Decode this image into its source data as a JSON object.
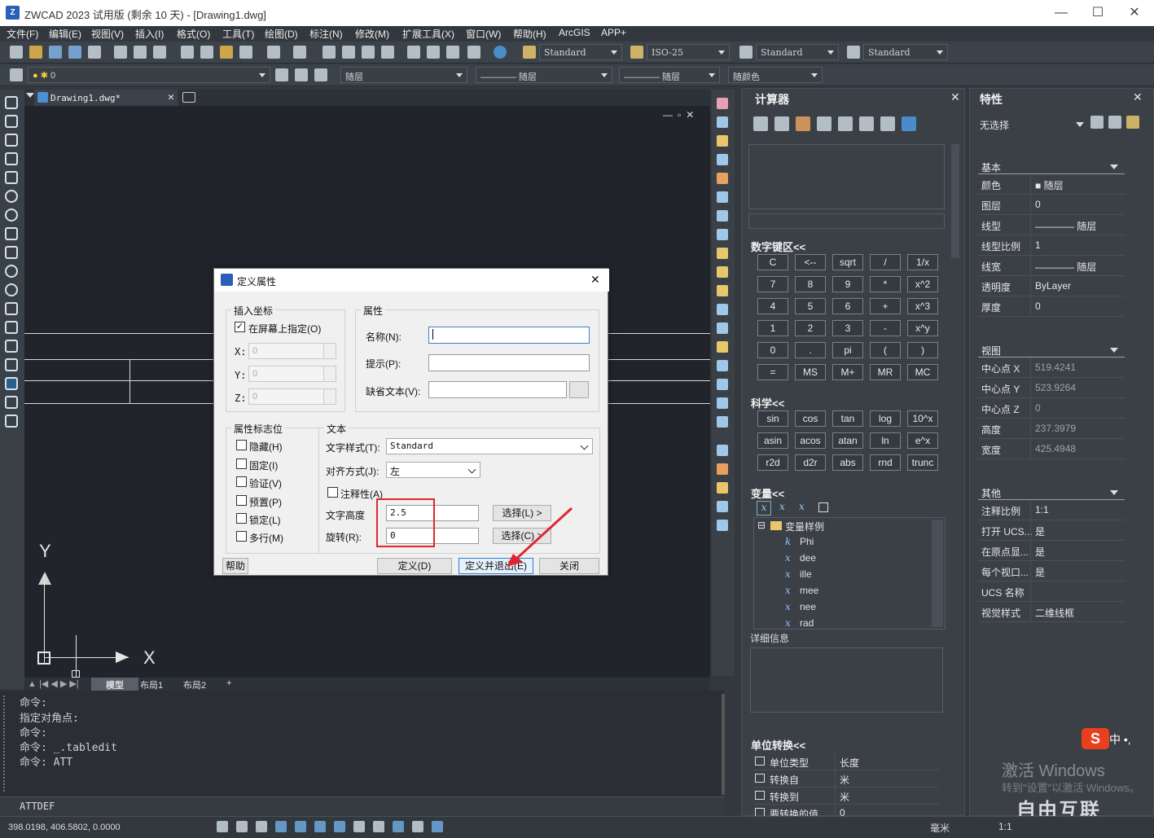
{
  "app": {
    "title": "ZWCAD 2023 试用版 (剩余 10 天) - [Drawing1.dwg]",
    "logo_text": "Z"
  },
  "window_controls": {
    "minimize": "—",
    "maximize": "☐",
    "close": "✕"
  },
  "menu": [
    "文件(F)",
    "编辑(E)",
    "视图(V)",
    "插入(I)",
    "格式(O)",
    "工具(T)",
    "绘图(D)",
    "标注(N)",
    "修改(M)",
    "扩展工具(X)",
    "窗口(W)",
    "帮助(H)",
    "ArcGIS",
    "APP+"
  ],
  "toolbar": {
    "text_style": "Standard",
    "dim_style": "ISO-25",
    "table_style": "Standard",
    "mleader_style": "Standard",
    "layer": "0",
    "color": "随层",
    "linetype": "———— 随层",
    "lineweight": "———— 随层",
    "plotstyle": "随颜色"
  },
  "document_tab": "Drawing1.dwg*",
  "canvas": {
    "ucs_y": "Y",
    "ucs_x": "X"
  },
  "layout_tabs": [
    "模型",
    "布局1",
    "布局2",
    "+"
  ],
  "command_lines": [
    "命令:",
    "指定对角点:",
    "命令:",
    "命令: _.tabledit",
    "命令: ATT"
  ],
  "command_input": "ATTDEF",
  "status": {
    "coords": "398.0198, 406.5802, 0.0000",
    "units": "毫米",
    "scale": "1:1"
  },
  "calculator": {
    "title": "计算器",
    "numpad_title": "数字键区<<",
    "numpad": [
      [
        "C",
        "<--",
        "sqrt",
        "/",
        "1/x"
      ],
      [
        "7",
        "8",
        "9",
        "*",
        "x^2"
      ],
      [
        "4",
        "5",
        "6",
        "+",
        "x^3"
      ],
      [
        "1",
        "2",
        "3",
        "-",
        "x^y"
      ],
      [
        "0",
        ".",
        "pi",
        "(",
        ")"
      ],
      [
        "=",
        "MS",
        "M+",
        "MR",
        "MC"
      ]
    ],
    "sci_title": "科学<<",
    "sci": [
      [
        "sin",
        "cos",
        "tan",
        "log",
        "10^x"
      ],
      [
        "asin",
        "acos",
        "atan",
        "ln",
        "e^x"
      ],
      [
        "r2d",
        "d2r",
        "abs",
        "rnd",
        "trunc"
      ]
    ],
    "var_title": "变量<<",
    "var_root": "变量样例",
    "variables": [
      "Phi",
      "dee",
      "ille",
      "mee",
      "nee",
      "rad"
    ],
    "detail_title": "详细信息",
    "unit_title": "单位转换<<",
    "unit_rows": [
      [
        "单位类型",
        "长度"
      ],
      [
        "转换自",
        "米"
      ],
      [
        "转换到",
        "米"
      ],
      [
        "要转换的值",
        "0"
      ]
    ]
  },
  "properties": {
    "title": "特性",
    "selection": "无选择",
    "basic_title": "基本",
    "basic": [
      [
        "颜色",
        "■ 随层"
      ],
      [
        "图层",
        "0"
      ],
      [
        "线型",
        "———— 随层"
      ],
      [
        "线型比例",
        "1"
      ],
      [
        "线宽",
        "———— 随层"
      ],
      [
        "透明度",
        "ByLayer"
      ],
      [
        "厚度",
        "0"
      ]
    ],
    "view_title": "视图",
    "view": [
      [
        "中心点 X",
        "519.4241"
      ],
      [
        "中心点 Y",
        "523.9264"
      ],
      [
        "中心点 Z",
        "0"
      ],
      [
        "高度",
        "237.3979"
      ],
      [
        "宽度",
        "425.4948"
      ]
    ],
    "other_title": "其他",
    "other": [
      [
        "注释比例",
        "1:1"
      ],
      [
        "打开 UCS...",
        "是"
      ],
      [
        "在原点显...",
        "是"
      ],
      [
        "每个视口...",
        "是"
      ],
      [
        "UCS 名称",
        ""
      ],
      [
        "视觉样式",
        "二维线框"
      ]
    ]
  },
  "watermark": {
    "line1": "激活 Windows",
    "line2": "转到\"设置\"以激活 Windows。",
    "brand": "自由互联"
  },
  "dialog": {
    "title": "定义属性",
    "insert_group": "插入坐标",
    "on_screen": "在屏幕上指定(O)",
    "x_label": "X:",
    "y_label": "Y:",
    "z_label": "Z:",
    "x_val": "0",
    "y_val": "0",
    "z_val": "0",
    "attr_group": "属性",
    "name_label": "名称(N):",
    "prompt_label": "提示(P):",
    "default_label": "缺省文本(V):",
    "flags_group": "属性标志位",
    "flags": [
      "隐藏(H)",
      "固定(I)",
      "验证(V)",
      "预置(P)",
      "锁定(L)",
      "多行(M)"
    ],
    "text_group": "文本",
    "style_label": "文字样式(T):",
    "style_val": "Standard",
    "just_label": "对齐方式(J):",
    "just_val": "左",
    "annot_label": "注释性(A)",
    "height_label": "文字高度",
    "height_val": "2.5",
    "rot_label": "旋转(R):",
    "rot_val": "0",
    "pick_height": "选择(L) >",
    "pick_rot": "选择(C) >",
    "help": "帮助",
    "define": "定义(D)",
    "define_exit": "定义并退出(E)",
    "close": "关闭"
  }
}
